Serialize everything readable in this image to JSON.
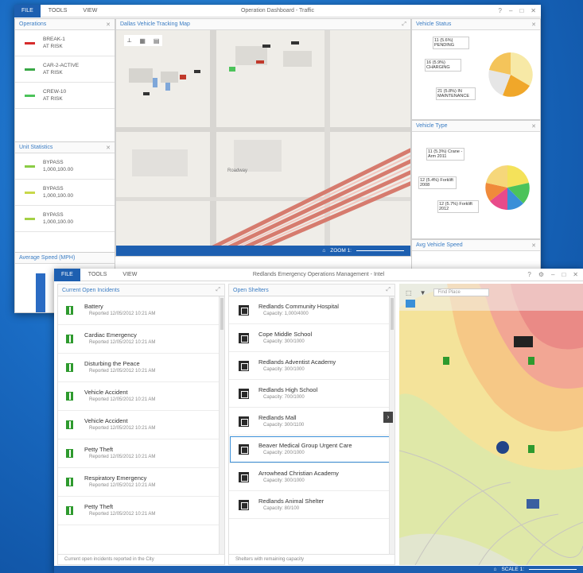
{
  "win1": {
    "tabs": [
      "FILE",
      "TOOLS",
      "VIEW"
    ],
    "title": "Operation Dashboard - Traffic",
    "panes": {
      "operations": {
        "title": "Operations",
        "items": [
          {
            "label": "BREAK-1",
            "sub": "AT RISK",
            "color": "#d62b2b"
          },
          {
            "label": "CAR-2-ACTIVE",
            "sub": "AT RISK",
            "color": "#3aa847"
          },
          {
            "label": "CREW-10",
            "sub": "AT RISK",
            "color": "#4cc35a"
          }
        ]
      },
      "units": {
        "title": "Unit Statistics",
        "items": [
          {
            "label": "BYPASS",
            "sub": "1,000,100.00",
            "color": "#8acc45"
          },
          {
            "label": "BYPASS",
            "sub": "1,000,100.00",
            "color": "#c8d84a"
          },
          {
            "label": "BYPASS",
            "sub": "1,000,100.00",
            "color": "#a4d045"
          }
        ]
      },
      "speed_title": "Average Speed (MPH)",
      "map_title": "Dallas Vehicle Tracking Map",
      "map_status": "ZOOM 1:",
      "vehicle_status": {
        "title": "Vehicle Status",
        "labels": [
          "11 (5.6%) PENDING",
          "16 (5.9%) CHARGING",
          "21 (5.8%) IN MAINTENANCE"
        ]
      },
      "vehicle_type": {
        "title": "Vehicle Type",
        "labels": [
          "11 (5.3%) Crane - Arm 2011",
          "12 (5.4%) Forklift 2008",
          "12 (5.7%) Forklift 2012"
        ]
      },
      "average_speed": "Avg Vehicle Speed"
    }
  },
  "win2": {
    "tabs": [
      "FILE",
      "TOOLS",
      "VIEW"
    ],
    "title": "Redlands Emergency Operations Management - Intel",
    "incidents": {
      "title": "Current Open Incidents",
      "footer": "Current open incidents reported in the City",
      "items": [
        {
          "name": "Battery",
          "time": "Reported 12/05/2012 10:21 AM"
        },
        {
          "name": "Cardiac Emergency",
          "time": "Reported 12/05/2012 10:21 AM"
        },
        {
          "name": "Disturbing the Peace",
          "time": "Reported 12/05/2012 10:21 AM"
        },
        {
          "name": "Vehicle Accident",
          "time": "Reported 12/05/2012 10:21 AM"
        },
        {
          "name": "Vehicle Accident",
          "time": "Reported 12/05/2012 10:21 AM"
        },
        {
          "name": "Petty Theft",
          "time": "Reported 12/05/2012 10:21 AM"
        },
        {
          "name": "Respiratory Emergency",
          "time": "Reported 12/05/2012 10:21 AM"
        },
        {
          "name": "Petty Theft",
          "time": "Reported 12/05/2012 10:21 AM"
        }
      ]
    },
    "shelters": {
      "title": "Open Shelters",
      "footer": "Shelters with remaining capacity",
      "items": [
        {
          "name": "Redlands Community Hospital",
          "cap": "Capacity: 1,000/4000"
        },
        {
          "name": "Cope Middle School",
          "cap": "Capacity: 300/1000"
        },
        {
          "name": "Redlands Adventist Academy",
          "cap": "Capacity: 300/1000"
        },
        {
          "name": "Redlands High School",
          "cap": "Capacity: 700/1000"
        },
        {
          "name": "Redlands Mall",
          "cap": "Capacity: 300/1100"
        },
        {
          "name": "Beaver Medical Group Urgent Care",
          "cap": "Capacity: 200/1000"
        },
        {
          "name": "Arrowhead Christian Academy",
          "cap": "Capacity: 300/1000"
        },
        {
          "name": "Redlands Animal Shelter",
          "cap": "Capacity: 80/100"
        }
      ]
    },
    "map_search_placeholder": "Find Place",
    "status_text": "SCALE 1:"
  }
}
